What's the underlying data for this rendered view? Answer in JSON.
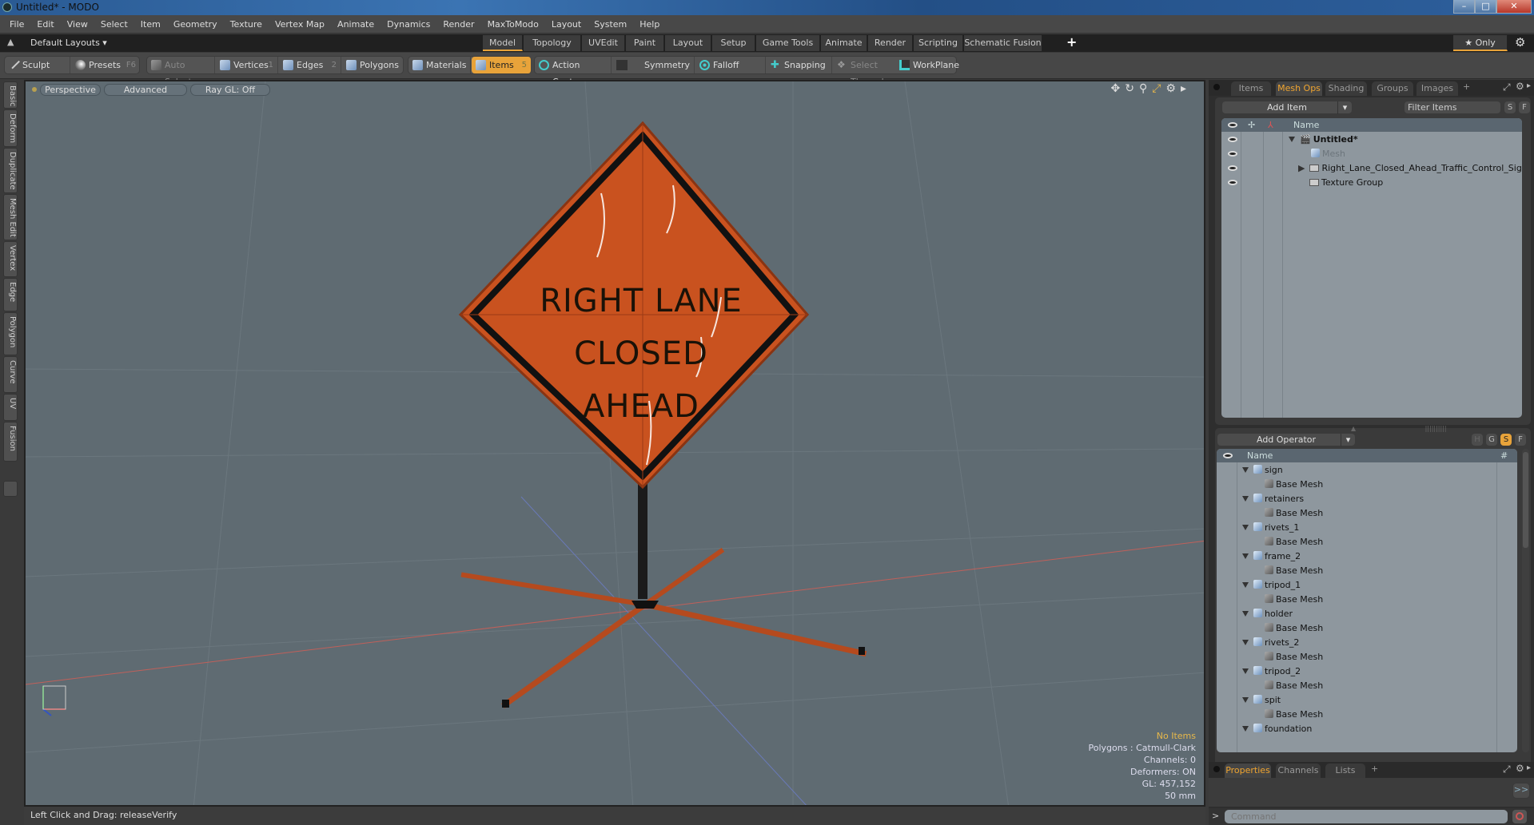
{
  "window": {
    "title": "Untitled* - MODO",
    "minimize": "–",
    "maximize": "□",
    "close": "✕"
  },
  "menu": [
    "File",
    "Edit",
    "View",
    "Select",
    "Item",
    "Geometry",
    "Texture",
    "Vertex Map",
    "Animate",
    "Dynamics",
    "Render",
    "MaxToModo",
    "Layout",
    "System",
    "Help"
  ],
  "layoutbar": {
    "layouts_label": "Default Layouts ▾",
    "tabs": [
      "Model",
      "Topology",
      "UVEdit",
      "Paint",
      "Layout",
      "Setup",
      "Game Tools",
      "Animate",
      "Render",
      "Scripting",
      "Schematic Fusion"
    ],
    "active_tab": "Model",
    "add_tab": "+",
    "only_label": "★ Only"
  },
  "toolbar": {
    "sculpt": "Sculpt",
    "presets": "Presets",
    "presets_key": "F6",
    "auto_select": "Auto Select",
    "vertices": "Vertices",
    "vertices_key": "1",
    "edges": "Edges",
    "edges_key": "2",
    "polygons": "Polygons",
    "materials": "Materials",
    "items": "Items",
    "items_key": "5",
    "action_center": "Action Center",
    "symmetry": "Symmetry",
    "falloff": "Falloff",
    "snapping": "Snapping",
    "select_through": "Select Through",
    "workplane": "WorkPlane"
  },
  "left_tabs": [
    "Basic",
    "Deform",
    "Duplicate",
    "Mesh Edit",
    "Vertex",
    "Edge",
    "Polygon",
    "Curve",
    "UV",
    "Fusion"
  ],
  "viewport": {
    "view_mode": "Perspective",
    "shading": "Advanced",
    "raygl": "Ray GL: Off",
    "sign_lines": [
      "RIGHT LANE",
      "CLOSED",
      "AHEAD"
    ],
    "info": {
      "selection": "No Items",
      "polygons": "Polygons : Catmull-Clark",
      "channels": "Channels: 0",
      "deformers": "Deformers: ON",
      "gl": "GL: 457,152",
      "focal": "50 mm"
    }
  },
  "status": {
    "text": "Left Click and Drag:   releaseVerify"
  },
  "items_panel": {
    "tabs": [
      "Items",
      "Mesh Ops",
      "Shading",
      "Groups",
      "Images"
    ],
    "active_tab": "Mesh Ops",
    "add_item": "Add Item",
    "filter_placeholder": "Filter Items",
    "s_btn": "S",
    "f_btn": "F",
    "column_name": "Name",
    "tree": [
      {
        "label": "Untitled*",
        "type": "scene"
      },
      {
        "label": "Mesh",
        "type": "mesh-dim"
      },
      {
        "label": "Right_Lane_Closed_Ahead_Traffic_Control_Sign ...",
        "type": "group"
      },
      {
        "label": "Texture Group",
        "type": "group"
      }
    ]
  },
  "meshops_panel": {
    "add_operator": "Add Operator",
    "buttons": [
      "H",
      "G",
      "S",
      "F"
    ],
    "active_button": "S",
    "column_name": "Name",
    "column_hash": "#",
    "items": [
      {
        "name": "sign",
        "child": "Base Mesh"
      },
      {
        "name": "retainers",
        "child": "Base Mesh"
      },
      {
        "name": "rivets_1",
        "child": "Base Mesh"
      },
      {
        "name": "frame_2",
        "child": "Base Mesh"
      },
      {
        "name": "tripod_1",
        "child": "Base Mesh"
      },
      {
        "name": "holder",
        "child": "Base Mesh"
      },
      {
        "name": "rivets_2",
        "child": "Base Mesh"
      },
      {
        "name": "tripod_2",
        "child": "Base Mesh"
      },
      {
        "name": "spit",
        "child": "Base Mesh"
      },
      {
        "name": "foundation",
        "child": ""
      }
    ]
  },
  "properties_panel": {
    "tabs": [
      "Properties",
      "Channels",
      "Lists"
    ],
    "active_tab": "Properties",
    "expand": ">>"
  },
  "command": {
    "placeholder": "Command",
    "prompt": ">"
  },
  "colors": {
    "accent": "#e8a33a",
    "sign_orange": "#c9521f",
    "viewport_bg": "#5f6b72"
  }
}
